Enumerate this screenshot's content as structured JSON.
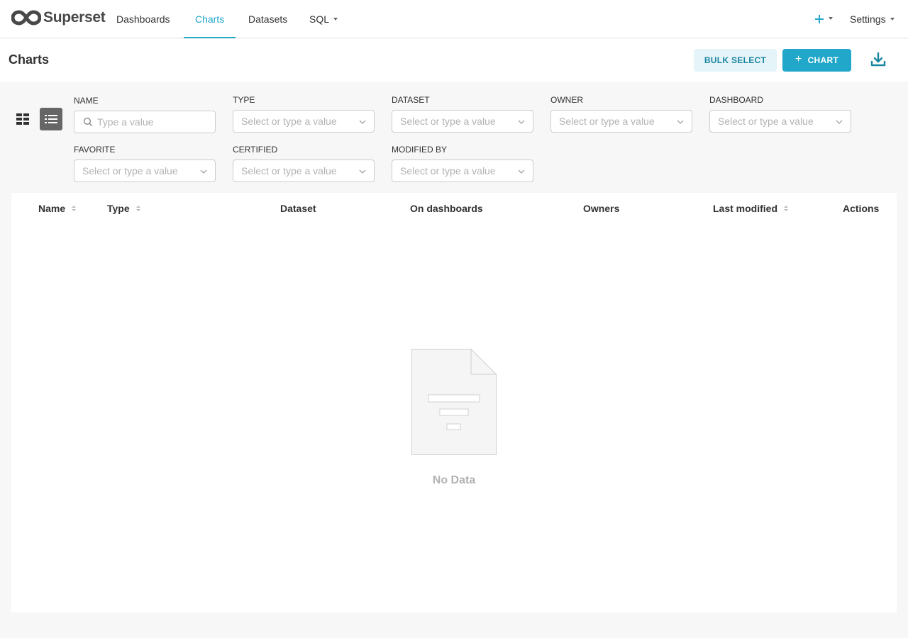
{
  "app": {
    "name": "Superset"
  },
  "nav": {
    "items": [
      {
        "label": "Dashboards",
        "active": false
      },
      {
        "label": "Charts",
        "active": true
      },
      {
        "label": "Datasets",
        "active": false
      },
      {
        "label": "SQL",
        "active": false
      }
    ],
    "settings_label": "Settings"
  },
  "header": {
    "title": "Charts",
    "bulk_select_label": "BULK SELECT",
    "add_chart_label": "CHART"
  },
  "filters": {
    "name": {
      "label": "NAME",
      "placeholder": "Type a value"
    },
    "type": {
      "label": "TYPE",
      "placeholder": "Select or type a value"
    },
    "dataset": {
      "label": "DATASET",
      "placeholder": "Select or type a value"
    },
    "owner": {
      "label": "OWNER",
      "placeholder": "Select or type a value"
    },
    "dashboard": {
      "label": "DASHBOARD",
      "placeholder": "Select or type a value"
    },
    "favorite": {
      "label": "FAVORITE",
      "placeholder": "Select or type a value"
    },
    "certified": {
      "label": "CERTIFIED",
      "placeholder": "Select or type a value"
    },
    "modified_by": {
      "label": "MODIFIED BY",
      "placeholder": "Select or type a value"
    }
  },
  "table": {
    "columns": [
      {
        "label": "Name",
        "sortable": true
      },
      {
        "label": "Type",
        "sortable": true
      },
      {
        "label": "Dataset",
        "sortable": false
      },
      {
        "label": "On dashboards",
        "sortable": false
      },
      {
        "label": "Owners",
        "sortable": false
      },
      {
        "label": "Last modified",
        "sortable": true
      },
      {
        "label": "Actions",
        "sortable": false
      }
    ],
    "empty_text": "No Data"
  },
  "colors": {
    "accent": "#20a7c9",
    "accent_light": "#e4f4f9",
    "text": "#323232",
    "muted": "#b2b2b2"
  },
  "icons": {
    "logo": "superset-infinity-logo",
    "plus_menu": "plus-icon",
    "download": "download-icon",
    "card_view": "grid-icon",
    "list_view": "list-icon",
    "search": "search-icon",
    "empty": "empty-document-icon"
  }
}
